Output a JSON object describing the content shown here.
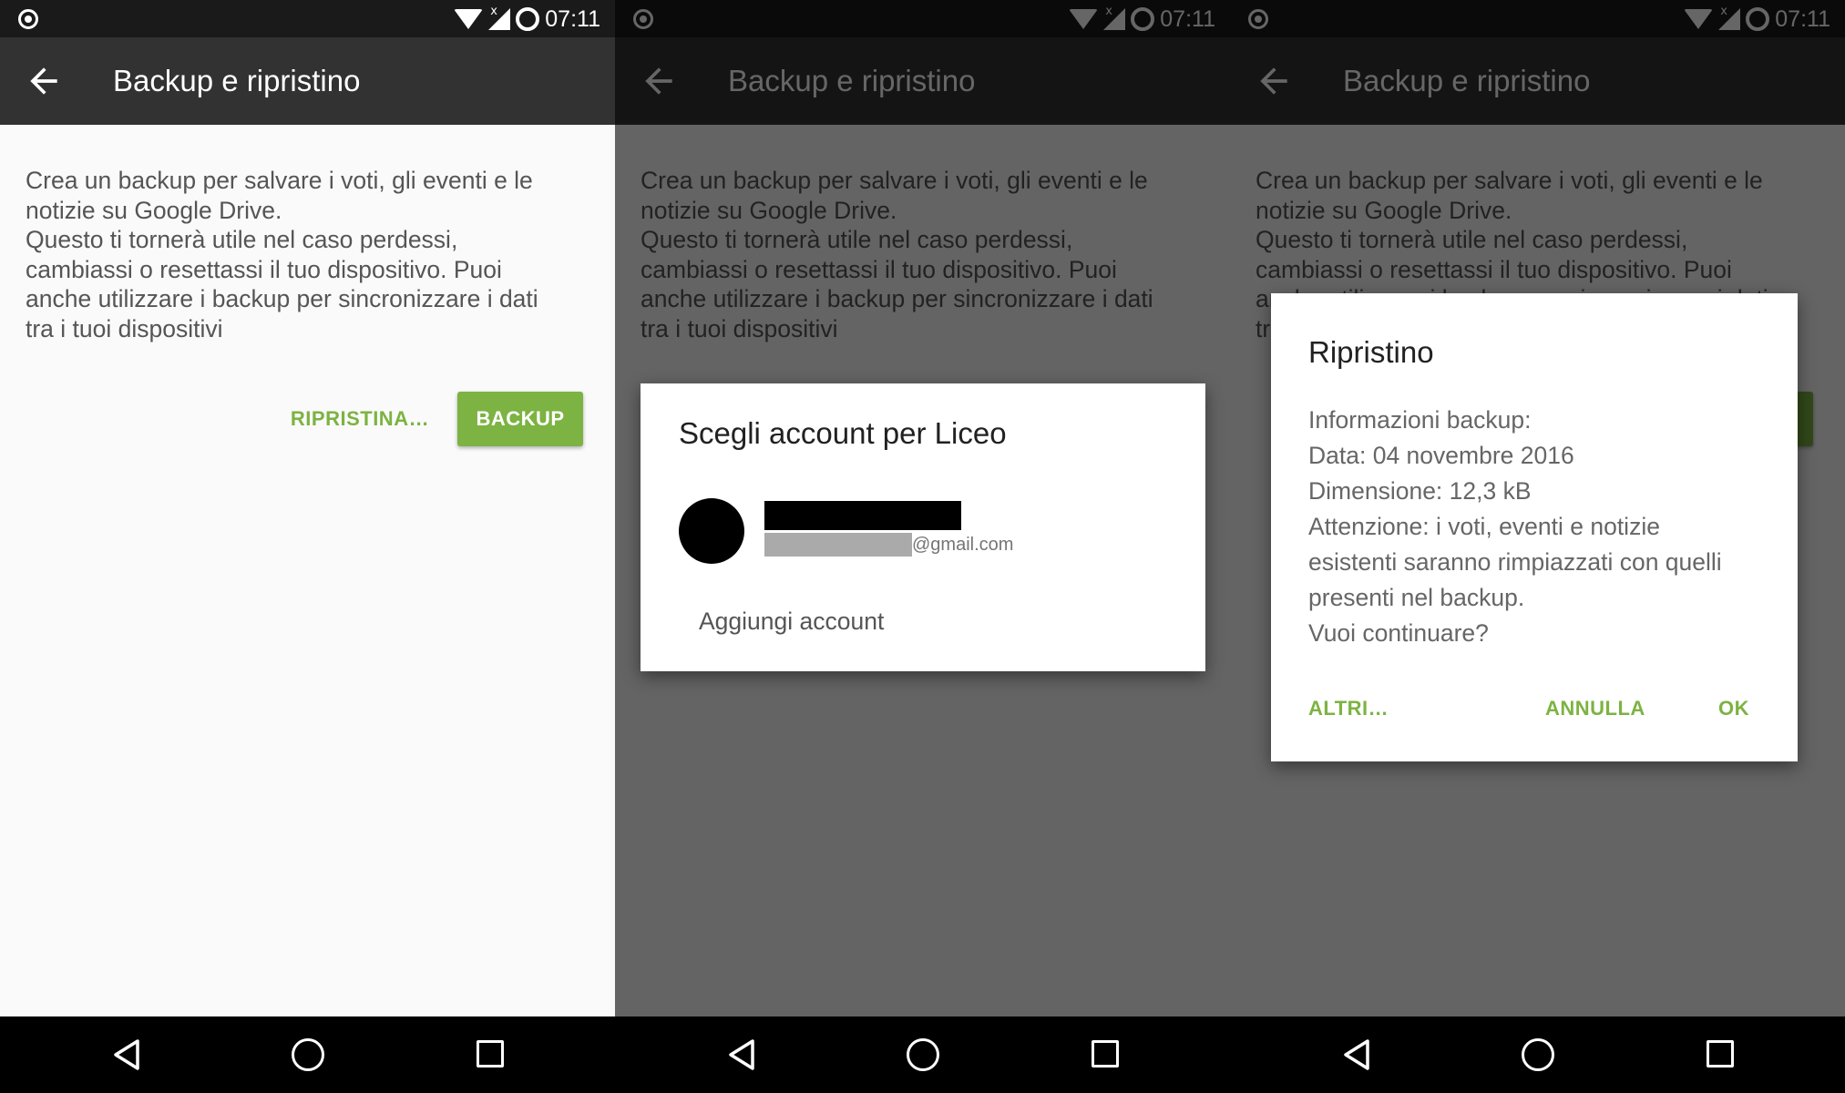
{
  "status_bar": {
    "time": "07:11"
  },
  "app_bar": {
    "title": "Backup e ripristino"
  },
  "content": {
    "description": "Crea un backup per salvare i voti, gli eventi e le\nnotizie su Google Drive.\nQuesto ti tornerà utile nel caso perdessi,\ncambiassi o resettassi il tuo dispositivo. Puoi\nanche utilizzare i backup per sincronizzare i dati\ntra i tuoi dispositivi",
    "restore_button": "RIPRISTINA…",
    "backup_button": "BACKUP"
  },
  "account_dialog": {
    "title": "Scegli account per Liceo",
    "account_email_domain": "@gmail.com",
    "add_account": "Aggiungi account"
  },
  "restore_dialog": {
    "title": "Ripristino",
    "message": "Informazioni backup:\nData: 04 novembre 2016\nDimensione: 12,3 kB\nAttenzione: i voti, eventi e notizie\nesistenti saranno rimpiazzati con quelli\npresenti nel backup.\nVuoi continuare?",
    "more_button": "ALTRI…",
    "cancel_button": "ANNULLA",
    "ok_button": "OK"
  },
  "colors": {
    "accent": "#7cb342",
    "app_bar": "#323232",
    "status_bar": "#1a1a1a",
    "background": "#fafafa"
  },
  "icons": {
    "status": [
      "gps-icon",
      "wifi-icon",
      "signal-icon",
      "battery-icon"
    ],
    "app_bar": "back-arrow-icon",
    "navigation": [
      "nav-back-icon",
      "nav-home-icon",
      "nav-recents-icon"
    ]
  }
}
